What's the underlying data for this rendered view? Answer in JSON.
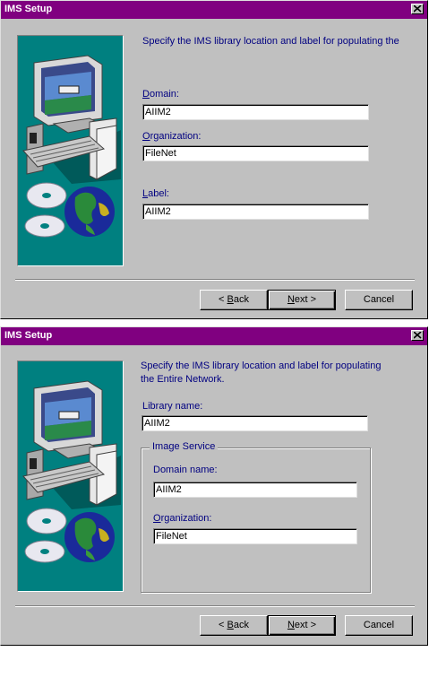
{
  "dialog1": {
    "title": "IMS Setup",
    "description": "Specify the IMS library location and label for populating the",
    "domain_label_u": "D",
    "domain_label_rest": "omain:",
    "domain_value": "AIIM2",
    "organization_label_u": "O",
    "organization_label_rest": "rganization:",
    "organization_value": "FileNet",
    "label_label_u": "L",
    "label_label_rest": "abel:",
    "label_value": "AIIM2",
    "back_prefix": "< ",
    "back_u": "B",
    "back_rest": "ack",
    "next_u": "N",
    "next_rest": "ext >",
    "cancel_label": "Cancel"
  },
  "dialog2": {
    "title": "IMS Setup",
    "description_line1": "Specify the IMS library location and label for populating",
    "description_line2": "the Entire Network.",
    "library_label": "Library name:",
    "library_value": "AIIM2",
    "group_legend": "Image Service",
    "domain_label": "Domain name:",
    "domain_value": "AIIM2",
    "organization_label_u": "O",
    "organization_label_rest": "rganization:",
    "organization_value": "FileNet",
    "back_prefix": "< ",
    "back_u": "B",
    "back_rest": "ack",
    "next_u": "N",
    "next_rest": "ext >",
    "cancel_label": "Cancel"
  },
  "colors": {
    "titlebar": "#800080",
    "dialog_face": "#c0c0c0",
    "illustration_bg": "#008080",
    "label_text": "#000080"
  },
  "icons": [
    "close-icon",
    "computer-illustration",
    "cd-icon",
    "globe-icon"
  ]
}
